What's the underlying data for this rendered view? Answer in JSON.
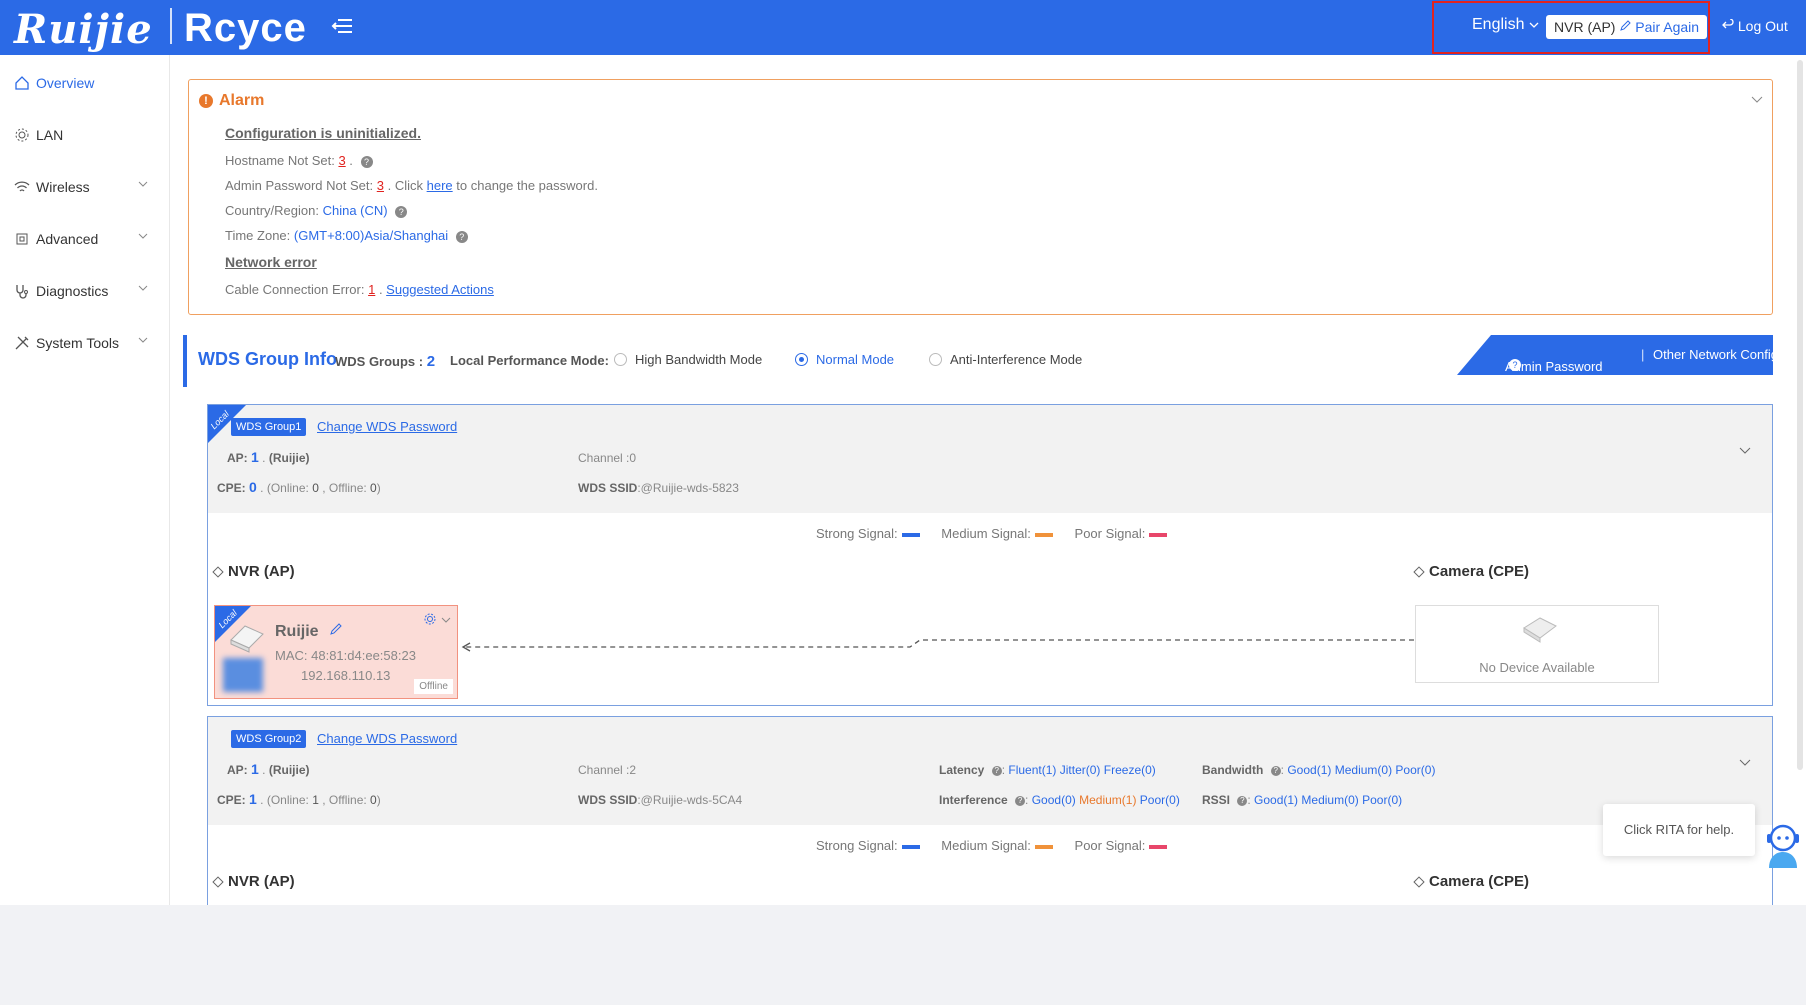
{
  "header": {
    "logo": "Ruijie",
    "logo2": "Rcyce",
    "language": "English",
    "device_label": "NVR (AP)",
    "pair_again": "Pair Again",
    "logout": "Log Out"
  },
  "sidebar": {
    "items": [
      {
        "label": "Overview"
      },
      {
        "label": "LAN"
      },
      {
        "label": "Wireless"
      },
      {
        "label": "Advanced"
      },
      {
        "label": "Diagnostics"
      },
      {
        "label": "System Tools"
      }
    ]
  },
  "alarm": {
    "title": "Alarm",
    "section1": "Configuration is uninitialized.",
    "hostname_label": "Hostname Not Set:",
    "hostname_count": "3",
    "admin_label": "Admin Password Not Set:",
    "admin_count": "3",
    "admin_click": ". Click",
    "admin_here": "here",
    "admin_rest": "to change the password.",
    "country_label": "Country/Region:",
    "country_value": "China (CN)",
    "timezone_label": "Time Zone:",
    "timezone_value": "(GMT+8:00)Asia/Shanghai",
    "section2": "Network error",
    "cable_label": "Cable Connection Error:",
    "cable_count": "1",
    "suggested": "Suggested Actions"
  },
  "wds": {
    "title": "WDS Group Info",
    "groups_label": "WDS Groups :",
    "groups_count": "2",
    "perf_label": "Local Performance Mode:",
    "mode_high": "High Bandwidth Mode",
    "mode_normal": "Normal Mode",
    "mode_anti": "Anti-Interference Mode",
    "admin_password": "Admin Password",
    "other_config": "Other Network Config"
  },
  "group1": {
    "corner": "Local",
    "badge": "WDS Group1",
    "change_pw": "Change WDS Password",
    "ap_label": "AP:",
    "ap_count": "1",
    "ap_brand": "(Ruijie)",
    "cpe_label": "CPE:",
    "cpe_count": "0",
    "online_label": "(Online:",
    "online": "0",
    "offline_label": ", Offline:",
    "offline": "0",
    "channel": "Channel :0",
    "ssid_label": "WDS SSID",
    "ssid": ":@Ruijie-wds-5823"
  },
  "group2": {
    "badge": "WDS Group2",
    "change_pw": "Change WDS Password",
    "ap_label": "AP:",
    "ap_count": "1",
    "ap_brand": "(Ruijie)",
    "cpe_label": "CPE:",
    "cpe_count": "1",
    "online_label": "(Online:",
    "online": "1",
    "offline_label": ", Offline:",
    "offline": "0",
    "channel": "Channel :2",
    "ssid_label": "WDS SSID",
    "ssid": ":@Ruijie-wds-5CA4",
    "latency_label": "Latency",
    "latency": [
      "Fluent(1)",
      "Jitter(0)",
      "Freeze(0)"
    ],
    "bandwidth_label": "Bandwidth",
    "bandwidth": [
      "Good(1)",
      "Medium(0)",
      "Poor(0)"
    ],
    "interference_label": "Interference",
    "interference": [
      "Good(0)",
      "Medium(1)",
      "Poor(0)"
    ],
    "rssi_label": "RSSI",
    "rssi": [
      "Good(1)",
      "Medium(0)",
      "Poor(0)"
    ]
  },
  "legend": {
    "strong": "Strong Signal:",
    "medium": "Medium Signal:",
    "poor": "Poor Signal:",
    "colors": {
      "strong": "#2b6ae6",
      "medium": "#f0923a",
      "poor": "#e8466a"
    }
  },
  "topology": {
    "ap_role": "NVR (AP)",
    "cpe_role": "Camera (CPE)",
    "device_corner": "Local",
    "device_name": "Ruijie",
    "mac_label": "MAC:",
    "mac": "48:81:d4:ee:58:23",
    "ip": "192.168.110.13",
    "status": "Offline",
    "no_device": "No Device Available"
  },
  "rita": {
    "help": "Click RITA for help."
  },
  "colors": {
    "brand": "#2b6ae6",
    "alarm": "#e8782c",
    "error": "#e1231f"
  }
}
